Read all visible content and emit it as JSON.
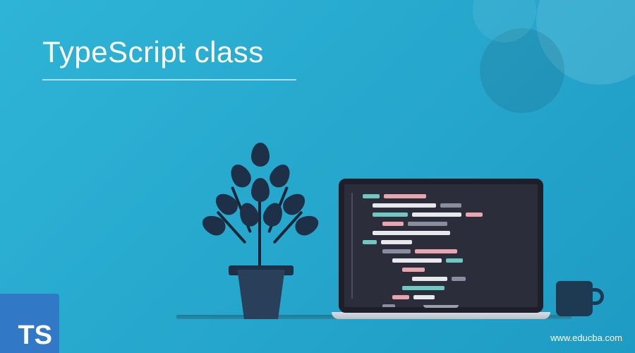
{
  "title": "TypeScript class",
  "logo": {
    "text": "TS"
  },
  "watermark": "www.educba.com",
  "colors": {
    "bg_start": "#2eb4d6",
    "bg_end": "#1e9bc4",
    "logo_bg": "#3178c6",
    "screen_bg": "#2b2d3a",
    "pot": "#2a3f5a",
    "leaf": "#1e3048",
    "mug": "#1e3a52"
  },
  "illustration": {
    "items": [
      "plant",
      "laptop",
      "mug",
      "desk"
    ],
    "laptop_code_rows": 14
  }
}
